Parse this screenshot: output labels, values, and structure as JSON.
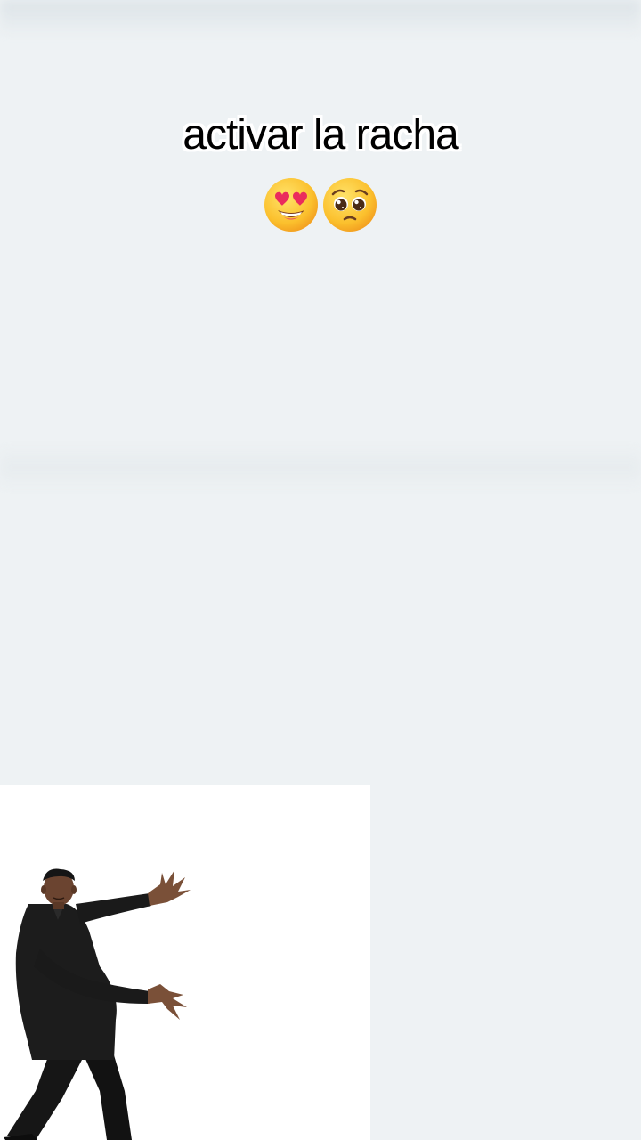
{
  "video": {
    "caption_text": "activar la racha",
    "emojis": [
      "heart-eyes-face",
      "pleading-face"
    ]
  },
  "sticker": {
    "subject": "man-in-black-suit-dancing-pose"
  },
  "colors": {
    "background": "#eef2f4",
    "panel": "#ffffff",
    "caption_text": "#000000",
    "caption_outline": "#ffffff"
  }
}
